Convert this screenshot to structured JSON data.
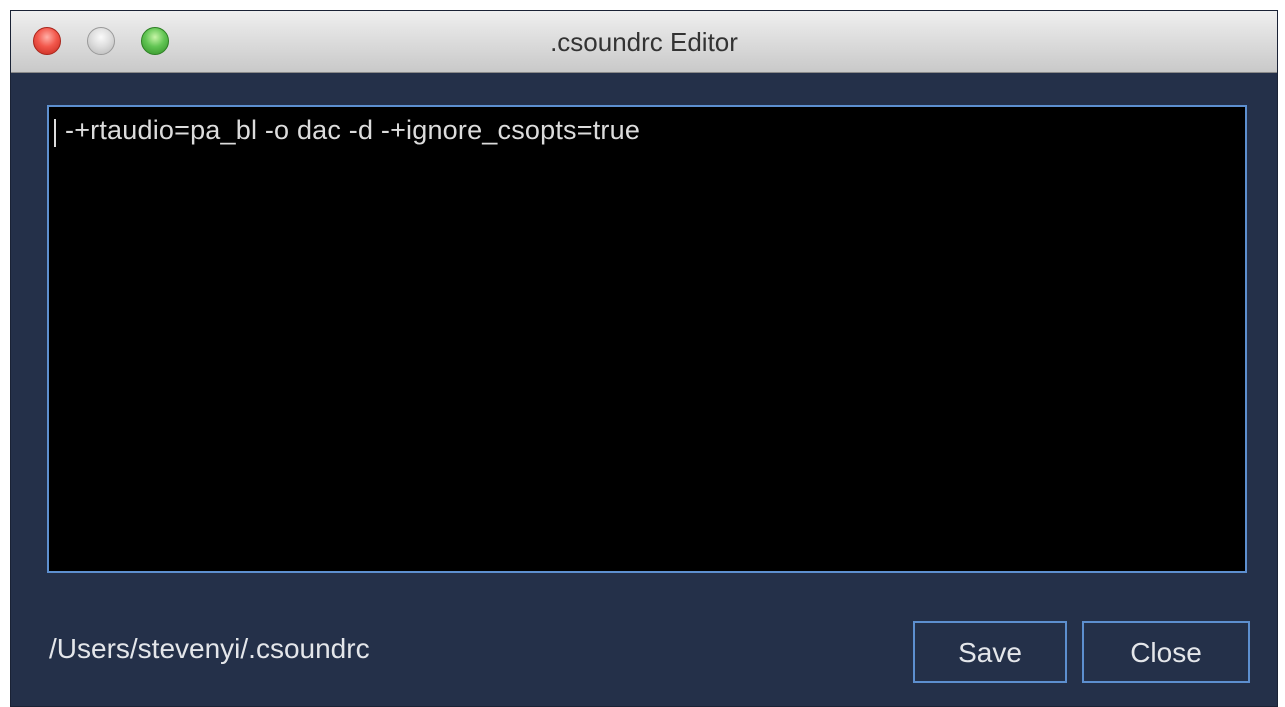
{
  "window": {
    "title": ".csoundrc Editor"
  },
  "editor": {
    "content": "-+rtaudio=pa_bl -o dac -d -+ignore_csopts=true"
  },
  "footer": {
    "file_path": "/Users/stevenyi/.csoundrc",
    "save_label": "Save",
    "close_label": "Close"
  },
  "colors": {
    "window_background": "#243049",
    "editor_background": "#000000",
    "accent_border": "#5d8fcf",
    "text": "#e4e6ea"
  },
  "icons": {
    "close": "close-icon",
    "minimize": "minimize-icon",
    "zoom": "zoom-icon"
  }
}
